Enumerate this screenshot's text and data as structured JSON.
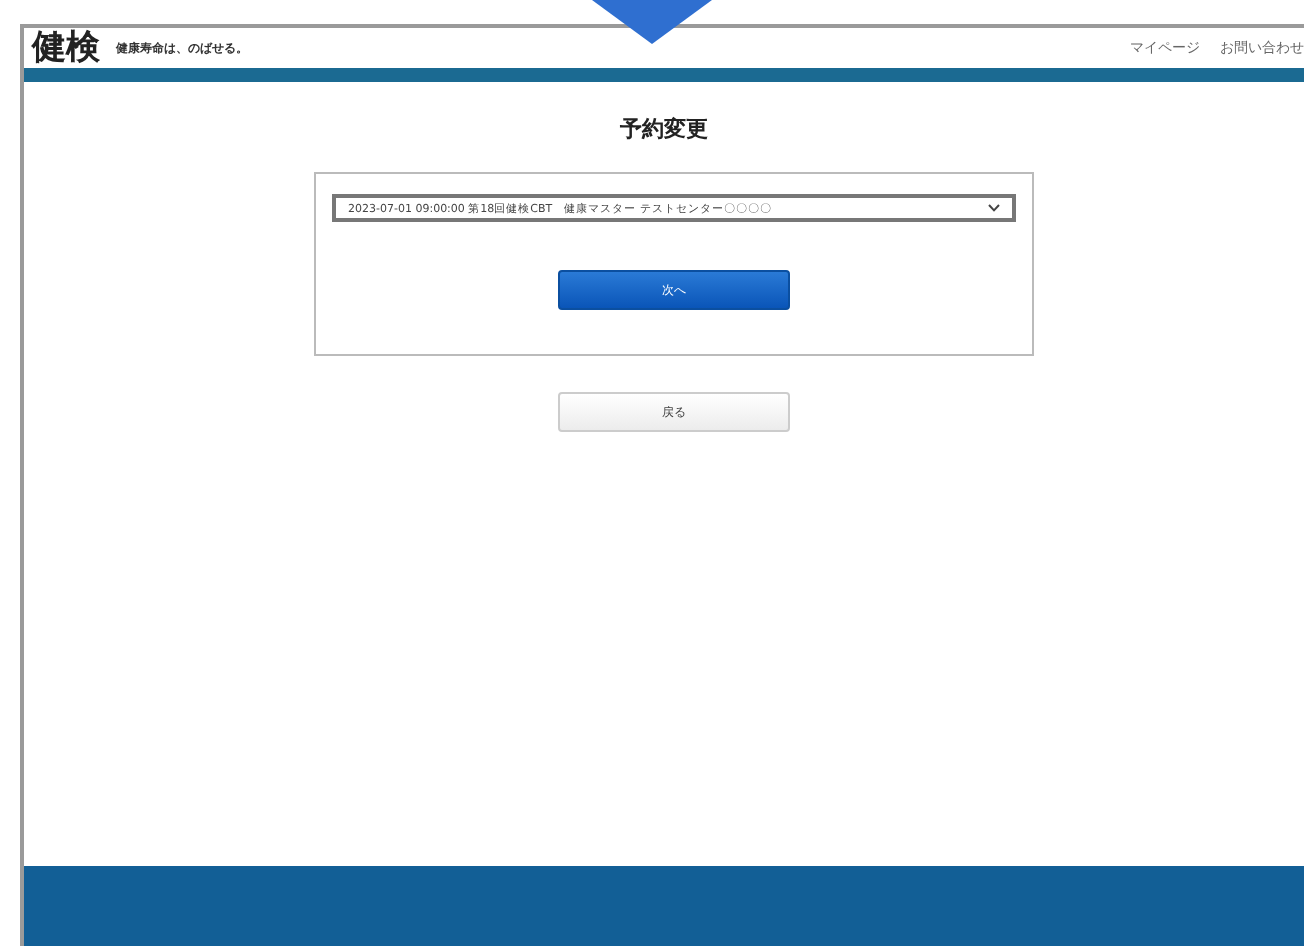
{
  "header": {
    "logo": "健検",
    "tagline": "健康寿命は、のばせる。",
    "links": [
      "マイページ",
      "お問い合わせ"
    ]
  },
  "page": {
    "title": "予約変更"
  },
  "form": {
    "select": {
      "value": "2023-07-01 09:00:00 第18回健検CBT　健康マスター テストセンター〇〇〇〇"
    },
    "next_button": "次へ"
  },
  "back_button": "戻る"
}
